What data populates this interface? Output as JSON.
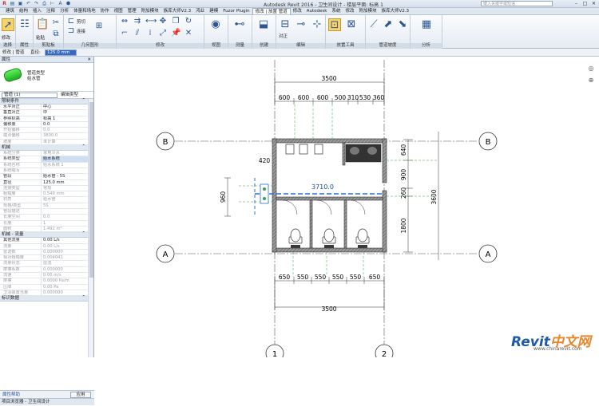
{
  "app": {
    "window_title": "Autodesk Revit 2016 -    卫生间设计 - 楼层平面: 标高 1",
    "search_placeholder": "键入关键字或短语"
  },
  "ribbon_tabs": [
    "建筑",
    "结构",
    "插入",
    "注释",
    "分析",
    "体量和场地",
    "协作",
    "视图",
    "管理",
    "附加模块",
    "族库大师V2.3",
    "鸿业",
    "建模",
    "Fuzor Plugin",
    "修改 | 放置 管道",
    "修改",
    "Autodesk",
    "系统",
    "修改",
    "附加模块",
    "族库大师V2.3"
  ],
  "ribbon": {
    "panels": [
      "选择",
      "属性",
      "剪贴板",
      "几何图形",
      "修改",
      "视图",
      "测量",
      "创建",
      "编辑",
      "放置工具",
      "管道坡度",
      "分析"
    ],
    "labels": {
      "modify": "修改",
      "properties": "属性",
      "paste": "粘贴",
      "cut": "剪切",
      "join": "连接",
      "align": "对正",
      "auto_connect": "自动连接",
      "inherit_elevation": "继承高程",
      "inherit_size": "继承大小",
      "add_vertical": "添加垂直",
      "change_slope": "更改坡度",
      "no_slope": "禁用坡度",
      "adjust_elbow": "调整风管/管道大小",
      "slope_value": "坡度值",
      "slope_off": "禁用坡度",
      "up_slope": "向上坡度",
      "down_slope": "向下坡度"
    }
  },
  "options_bar": {
    "label_modify": "修改 | 管道",
    "label_diameter": "直径:",
    "diameter_value": "125.0 mm"
  },
  "properties": {
    "header": "属性",
    "type_family": "管道类型",
    "type_name": "给水管",
    "instance_dropdown": "管道 (1)",
    "edit_type": "编辑类型",
    "sections": [
      {
        "name": "限制条件",
        "rows": [
          {
            "k": "水平对正",
            "v": "中心"
          },
          {
            "k": "垂直对正",
            "v": "中"
          },
          {
            "k": "参照标高",
            "v": "标高 1"
          },
          {
            "k": "偏移量",
            "v": "0.0"
          },
          {
            "k": "开始偏移",
            "v": "0.0",
            "grey": true
          },
          {
            "k": "端点偏移",
            "v": "3800.0",
            "grey": true
          },
          {
            "k": "坡度",
            "v": "未计算",
            "grey": true
          }
        ]
      },
      {
        "name": "机械",
        "rows": [
          {
            "k": "系统分类",
            "v": "家用冷水",
            "grey": true
          },
          {
            "k": "系统类型",
            "v": "给水系统",
            "hl": true
          },
          {
            "k": "系统名称",
            "v": "给水系统 1",
            "grey": true
          },
          {
            "k": "系统缩写",
            "v": "",
            "grey": true
          },
          {
            "k": "管段",
            "v": "给水管 - 5S"
          },
          {
            "k": "直径",
            "v": "125.0 mm"
          },
          {
            "k": "连接类型",
            "v": "常规",
            "grey": true
          },
          {
            "k": "粗糙度",
            "v": "0.549 mm",
            "grey": true
          },
          {
            "k": "材质",
            "v": "给水管",
            "grey": true
          },
          {
            "k": "规格/类型",
            "v": "5S",
            "grey": true
          },
          {
            "k": "管段描述",
            "v": "",
            "grey": true
          },
          {
            "k": "长度空间",
            "v": "0.0",
            "grey": true
          },
          {
            "k": "长度",
            "v": "1",
            "grey": true
          },
          {
            "k": "面积",
            "v": "1.492 m²",
            "grey": true
          }
        ]
      },
      {
        "name": "机械 - 流量",
        "rows": [
          {
            "k": "其他流量",
            "v": "0.00 L/s"
          },
          {
            "k": "流量",
            "v": "0.00 L/s",
            "grey": true
          },
          {
            "k": "雷诺数",
            "v": "0.000000",
            "grey": true
          },
          {
            "k": "相对粗糙度",
            "v": "0.004041",
            "grey": true
          },
          {
            "k": "流量状态",
            "v": "层流",
            "grey": true
          },
          {
            "k": "摩擦系数",
            "v": "0.000000",
            "grey": true
          },
          {
            "k": "流速",
            "v": "0.00 m/s",
            "grey": true
          },
          {
            "k": "摩擦",
            "v": "0.0000 Pa/m",
            "grey": true
          },
          {
            "k": "压降",
            "v": "0.00 Pa",
            "grey": true
          },
          {
            "k": "卫浴装置当量",
            "v": "0.000000",
            "grey": true
          }
        ]
      }
    ],
    "next_section": "标识数据",
    "help_link": "属性帮助",
    "apply_button": "应用",
    "browser_header": "项目浏览器 - 卫生间设计"
  },
  "drawing": {
    "grids": {
      "B": "B",
      "A": "A",
      "g1": "1",
      "g2": "2"
    },
    "dims_top": {
      "total": "3500",
      "segs": [
        "600",
        "600",
        "600",
        "500",
        "310",
        "530",
        "360"
      ]
    },
    "dims_bottom": {
      "total": "3500",
      "segs": [
        "650",
        "550",
        "550",
        "550",
        "550",
        "650"
      ]
    },
    "dims_right": {
      "total": "3600",
      "segs": [
        "640",
        "900",
        "260",
        "1800"
      ]
    },
    "dim_left": "960",
    "dim_420": "420",
    "pipe_label": "3710.0"
  },
  "watermark": {
    "logo": "Revit",
    "logo_cn": "中文网",
    "url": "www.chinarevit.com"
  }
}
